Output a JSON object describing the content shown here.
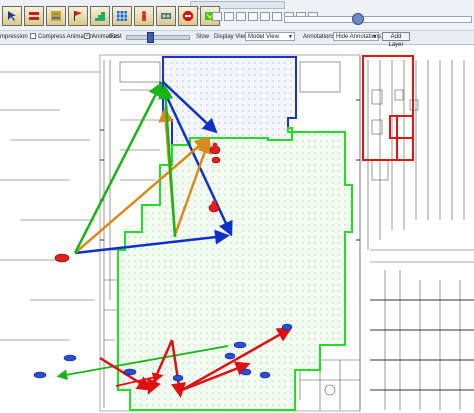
{
  "toolbar": {
    "big_icons": [
      {
        "name": "pointer-tool-icon"
      },
      {
        "name": "wall-tool-icon"
      },
      {
        "name": "cabinet-tool-icon"
      },
      {
        "name": "flag-tool-icon"
      },
      {
        "name": "stair-tool-icon"
      },
      {
        "name": "grid-tool-icon"
      },
      {
        "name": "person-tool-icon"
      },
      {
        "name": "equipment-tool-icon"
      },
      {
        "name": "stop-tool-icon"
      },
      {
        "name": "map-tool-icon"
      }
    ],
    "small_tools": [
      "brush-icon",
      "path-icon",
      "line-icon",
      "circle-icon",
      "grid-icon",
      "palette-icon",
      "box-icon",
      "number-icon",
      "minus-icon"
    ]
  },
  "options_bar": {
    "compression_label": "mpression",
    "compress_animation_label": "Compress Animation",
    "animation_label": "Animation",
    "fast_label": "Fast",
    "slow_label": "Slow",
    "display_view_label": "Display View",
    "model_view_value": "Model View",
    "annotations_label": "Annotations",
    "hide_annotations_value": "Hide Annotations",
    "add_layer_label": "Add Layer"
  },
  "colors": {
    "blue_zone": "#1f2fd0",
    "green_zone": "#22dd22",
    "red_zone": "#e31414",
    "blue_arrow": "#1030c8",
    "orange_arrow": "#d88a1a",
    "green_arrow": "#18b418",
    "red_arrow": "#e01010"
  }
}
